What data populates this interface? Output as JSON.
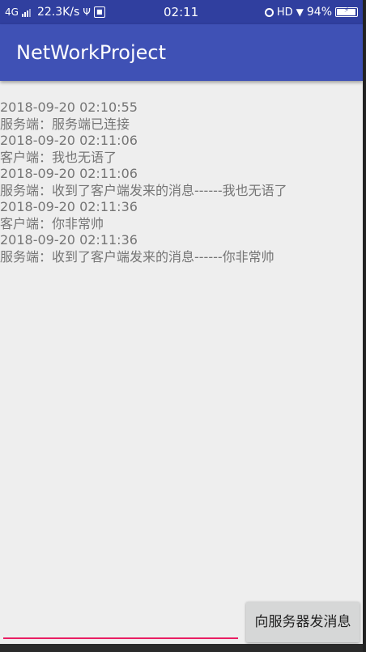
{
  "status_bar": {
    "network": "4G",
    "speed": "22.3K/s",
    "time": "02:11",
    "hd": "HD",
    "battery": "94%",
    "battery_level": 0.94,
    "icons": [
      "signal-icon",
      "usb-icon",
      "notification-icon",
      "alarm-icon",
      "wifi-icon",
      "battery-icon"
    ]
  },
  "app_bar": {
    "title": "NetWorkProject",
    "color": "#3f51b5"
  },
  "messages": [
    "2018-09-20 02:10:55",
    "服务端：服务端已连接",
    "2018-09-20 02:11:06",
    "客户端：我也无语了",
    "2018-09-20 02:11:06",
    "服务端：收到了客户端发来的消息------我也无语了",
    "2018-09-20 02:11:36",
    "客户端：你非常帅",
    "2018-09-20 02:11:36",
    "服务端：收到了客户端发来的消息------你非常帅"
  ],
  "input": {
    "value": "",
    "underline_color": "#e91e63"
  },
  "send_button": {
    "label": "向服务器发消息"
  }
}
